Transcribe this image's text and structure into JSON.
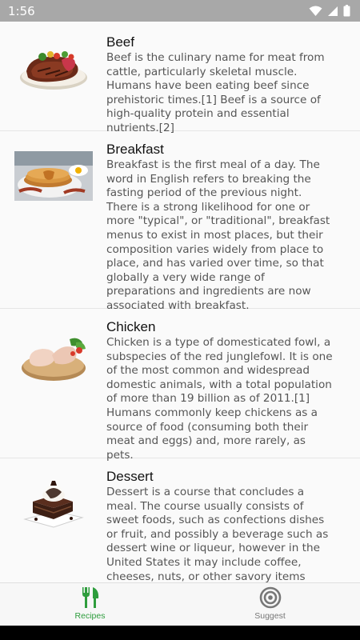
{
  "status_bar": {
    "time": "1:56",
    "icons": [
      "wifi-icon",
      "signal-icon",
      "battery-icon"
    ]
  },
  "recipes": [
    {
      "title": "Beef",
      "description": "Beef is the culinary name for meat from cattle, particularly skeletal muscle. Humans have been eating beef since prehistoric times.[1] Beef is a source of high-quality protein and essential nutrients.[2]",
      "image": "beef-steak-image"
    },
    {
      "title": "Breakfast",
      "description": "Breakfast is the first meal of a day. The word in English refers to breaking the fasting period of the previous night. There is a strong likelihood for one or more \"typical\", or \"traditional\", breakfast menus to exist in most places, but their composition varies widely from place to place, and has varied over time, so that globally a very wide range of preparations and ingredients are now associated with breakfast.",
      "image": "breakfast-pancakes-image"
    },
    {
      "title": "Chicken",
      "description": "Chicken is a type of domesticated fowl, a subspecies of the red junglefowl. It is one of the most common and widespread domestic animals, with a total population of more than 19 billion as of 2011.[1] Humans commonly keep chickens as a source of food (consuming both their meat and eggs) and, more rarely, as pets.",
      "image": "chicken-legs-image"
    },
    {
      "title": "Dessert",
      "description": "Dessert is a course that concludes a meal. The course usually consists of sweet foods, such as confections dishes or fruit, and possibly a beverage such as dessert wine or liqueur, however in the United States it may include coffee, cheeses, nuts, or other savory items regarded as a separate course",
      "image": "chocolate-dessert-image"
    }
  ],
  "bottom_nav": {
    "tabs": [
      {
        "label": "Recipes",
        "icon": "fork-knife-icon",
        "active": true
      },
      {
        "label": "Suggest",
        "icon": "target-icon",
        "active": false
      }
    ]
  },
  "colors": {
    "accent": "#2e9d3d",
    "status_bar": "#a8a8a8",
    "inactive": "#777777"
  }
}
